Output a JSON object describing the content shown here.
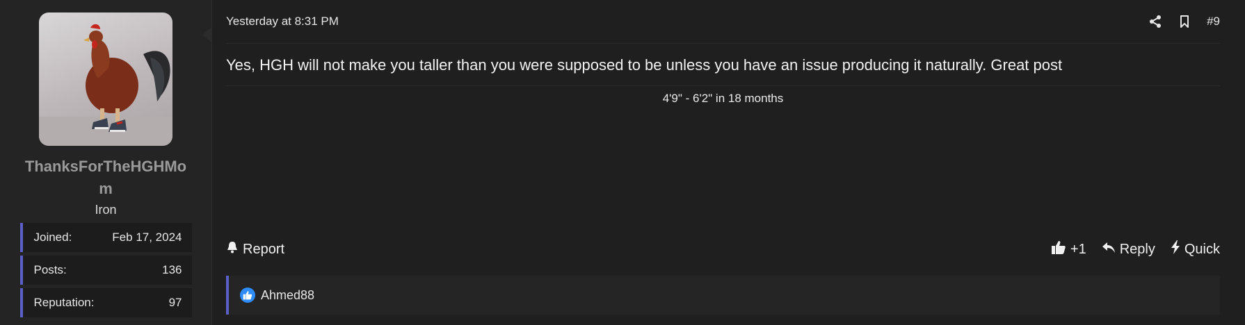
{
  "user": {
    "username": "ThanksForTheHGHMom",
    "rank": "Iron",
    "stats": [
      {
        "label": "Joined:",
        "value": "Feb 17, 2024"
      },
      {
        "label": "Posts:",
        "value": "136"
      },
      {
        "label": "Reputation:",
        "value": "97"
      }
    ]
  },
  "post": {
    "timestamp": "Yesterday at 8:31 PM",
    "number": "#9",
    "message": "Yes, HGH will not make you taller than you were supposed to be unless you have an issue producing it naturally. Great post",
    "signature": "4'9\" - 6'2\" in 18 months"
  },
  "actions": {
    "report": "Report",
    "like": "+1",
    "reply": "Reply",
    "quick": "Quick"
  },
  "reactions": {
    "users": "Ahmed88"
  },
  "colors": {
    "accent": "#5b5fc7",
    "like_badge": "#2f8cff",
    "background": "#1f1f1f"
  },
  "icons": [
    "share-icon",
    "bookmark-icon",
    "bell-icon",
    "thumbs-up-icon",
    "reply-icon",
    "bolt-icon"
  ]
}
